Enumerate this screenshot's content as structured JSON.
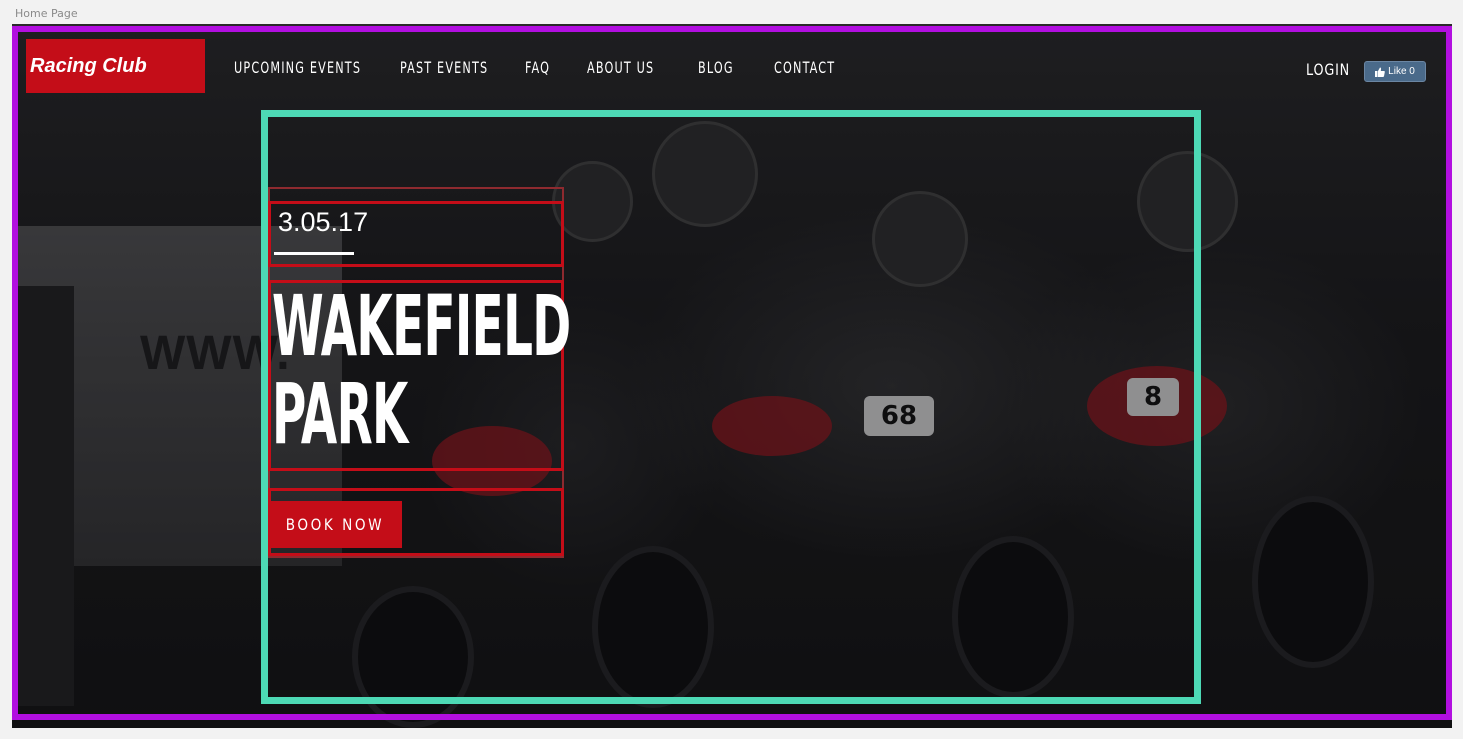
{
  "page_label": "Home Page",
  "brand": {
    "name": "Racing Club",
    "accent_color": "#c40d18"
  },
  "nav": {
    "items": [
      {
        "label": "UPCOMING EVENTS"
      },
      {
        "label": "PAST EVENTS"
      },
      {
        "label": "FAQ"
      },
      {
        "label": "ABOUT US"
      },
      {
        "label": "BLOG"
      },
      {
        "label": "CONTACT"
      }
    ],
    "login_label": "LOGIN",
    "like_label": "Like 0"
  },
  "hero": {
    "date": "3.05.17",
    "title_line1": "WAKEFIELD",
    "title_line2": "PARK",
    "cta_label": "BOOK NOW",
    "photo_watermark": "WWW.",
    "plate_numbers": [
      "68",
      "8"
    ]
  },
  "editor": {
    "outer_frame_color": "#b20fe0",
    "inner_frame_color": "#4dd9b5"
  }
}
